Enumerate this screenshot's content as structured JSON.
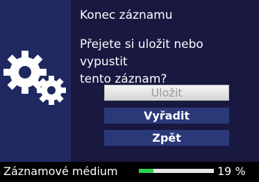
{
  "dialog": {
    "title": "Konec záznamu",
    "question_line1": "Přejete si uložit nebo vypustit",
    "question_line2": "tento záznam?",
    "buttons": {
      "save": "Uložit",
      "discard": "Vyřadit",
      "back": "Zpět"
    }
  },
  "status": {
    "label": "Záznamové médium",
    "percent_text": "19 %",
    "usage_fraction": 0.19
  },
  "colors": {
    "dialog_background": "#181840",
    "left_panel": "#1f2960",
    "button_active": "#2c3978",
    "button_selected": "#e6e6e6",
    "progress_fill": "#2bd24b"
  },
  "icons": [
    "gears-icon"
  ]
}
